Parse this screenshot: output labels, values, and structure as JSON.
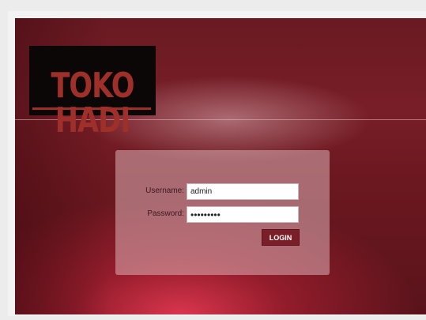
{
  "header": {
    "logo_text": "TOKO HADI"
  },
  "login": {
    "username_label": "Username:",
    "username_value": "admin",
    "password_label": "Password:",
    "password_value": "•••••••••",
    "login_button": "LOGIN"
  },
  "colors": {
    "background_dark": "#6a1a22",
    "logo_red": "#9e2f29",
    "button": "#7a1e27"
  }
}
